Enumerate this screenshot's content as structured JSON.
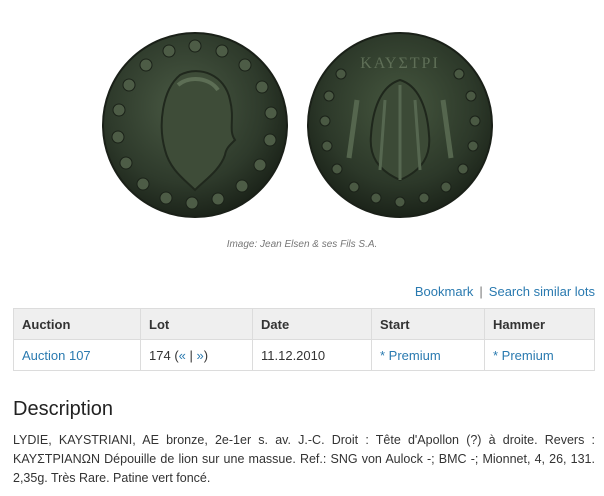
{
  "image": {
    "caption": "Image: Jean Elsen & ses Fils S.A.",
    "reverse_legend": "ΚΑΥΣΤΡΙ"
  },
  "links": {
    "bookmark": "Bookmark",
    "separator": "|",
    "search_similar": "Search similar lots"
  },
  "table": {
    "headers": [
      "Auction",
      "Lot",
      "Date",
      "Start",
      "Hammer"
    ],
    "row": {
      "auction": "Auction 107",
      "lot_number": "174",
      "lot_nav_open": "(",
      "lot_prev": "«",
      "lot_nav_sep": "|",
      "lot_next": "»",
      "lot_nav_close": ")",
      "date": "11.12.2010",
      "start": "* Premium",
      "hammer": "* Premium"
    }
  },
  "description": {
    "title": "Description",
    "text": "LYDIE, KAYSTRIANI, AE bronze, 2e-1er s. av. J.-C. Droit : Tête d'Apollon (?) à droite. Revers : ΚΑΥΣΤΡΙΑΝΩΝ Dépouille de lion sur une massue. Ref.: SNG von Aulock -; BMC -; Mionnet, 4, 26, 131. 2,35g. Très Rare. Patine vert foncé."
  },
  "colors": {
    "link": "#2a7ab0",
    "header_bg": "#efefef",
    "border": "#dcdcdc",
    "coin_patina": "#2f3a2c"
  }
}
